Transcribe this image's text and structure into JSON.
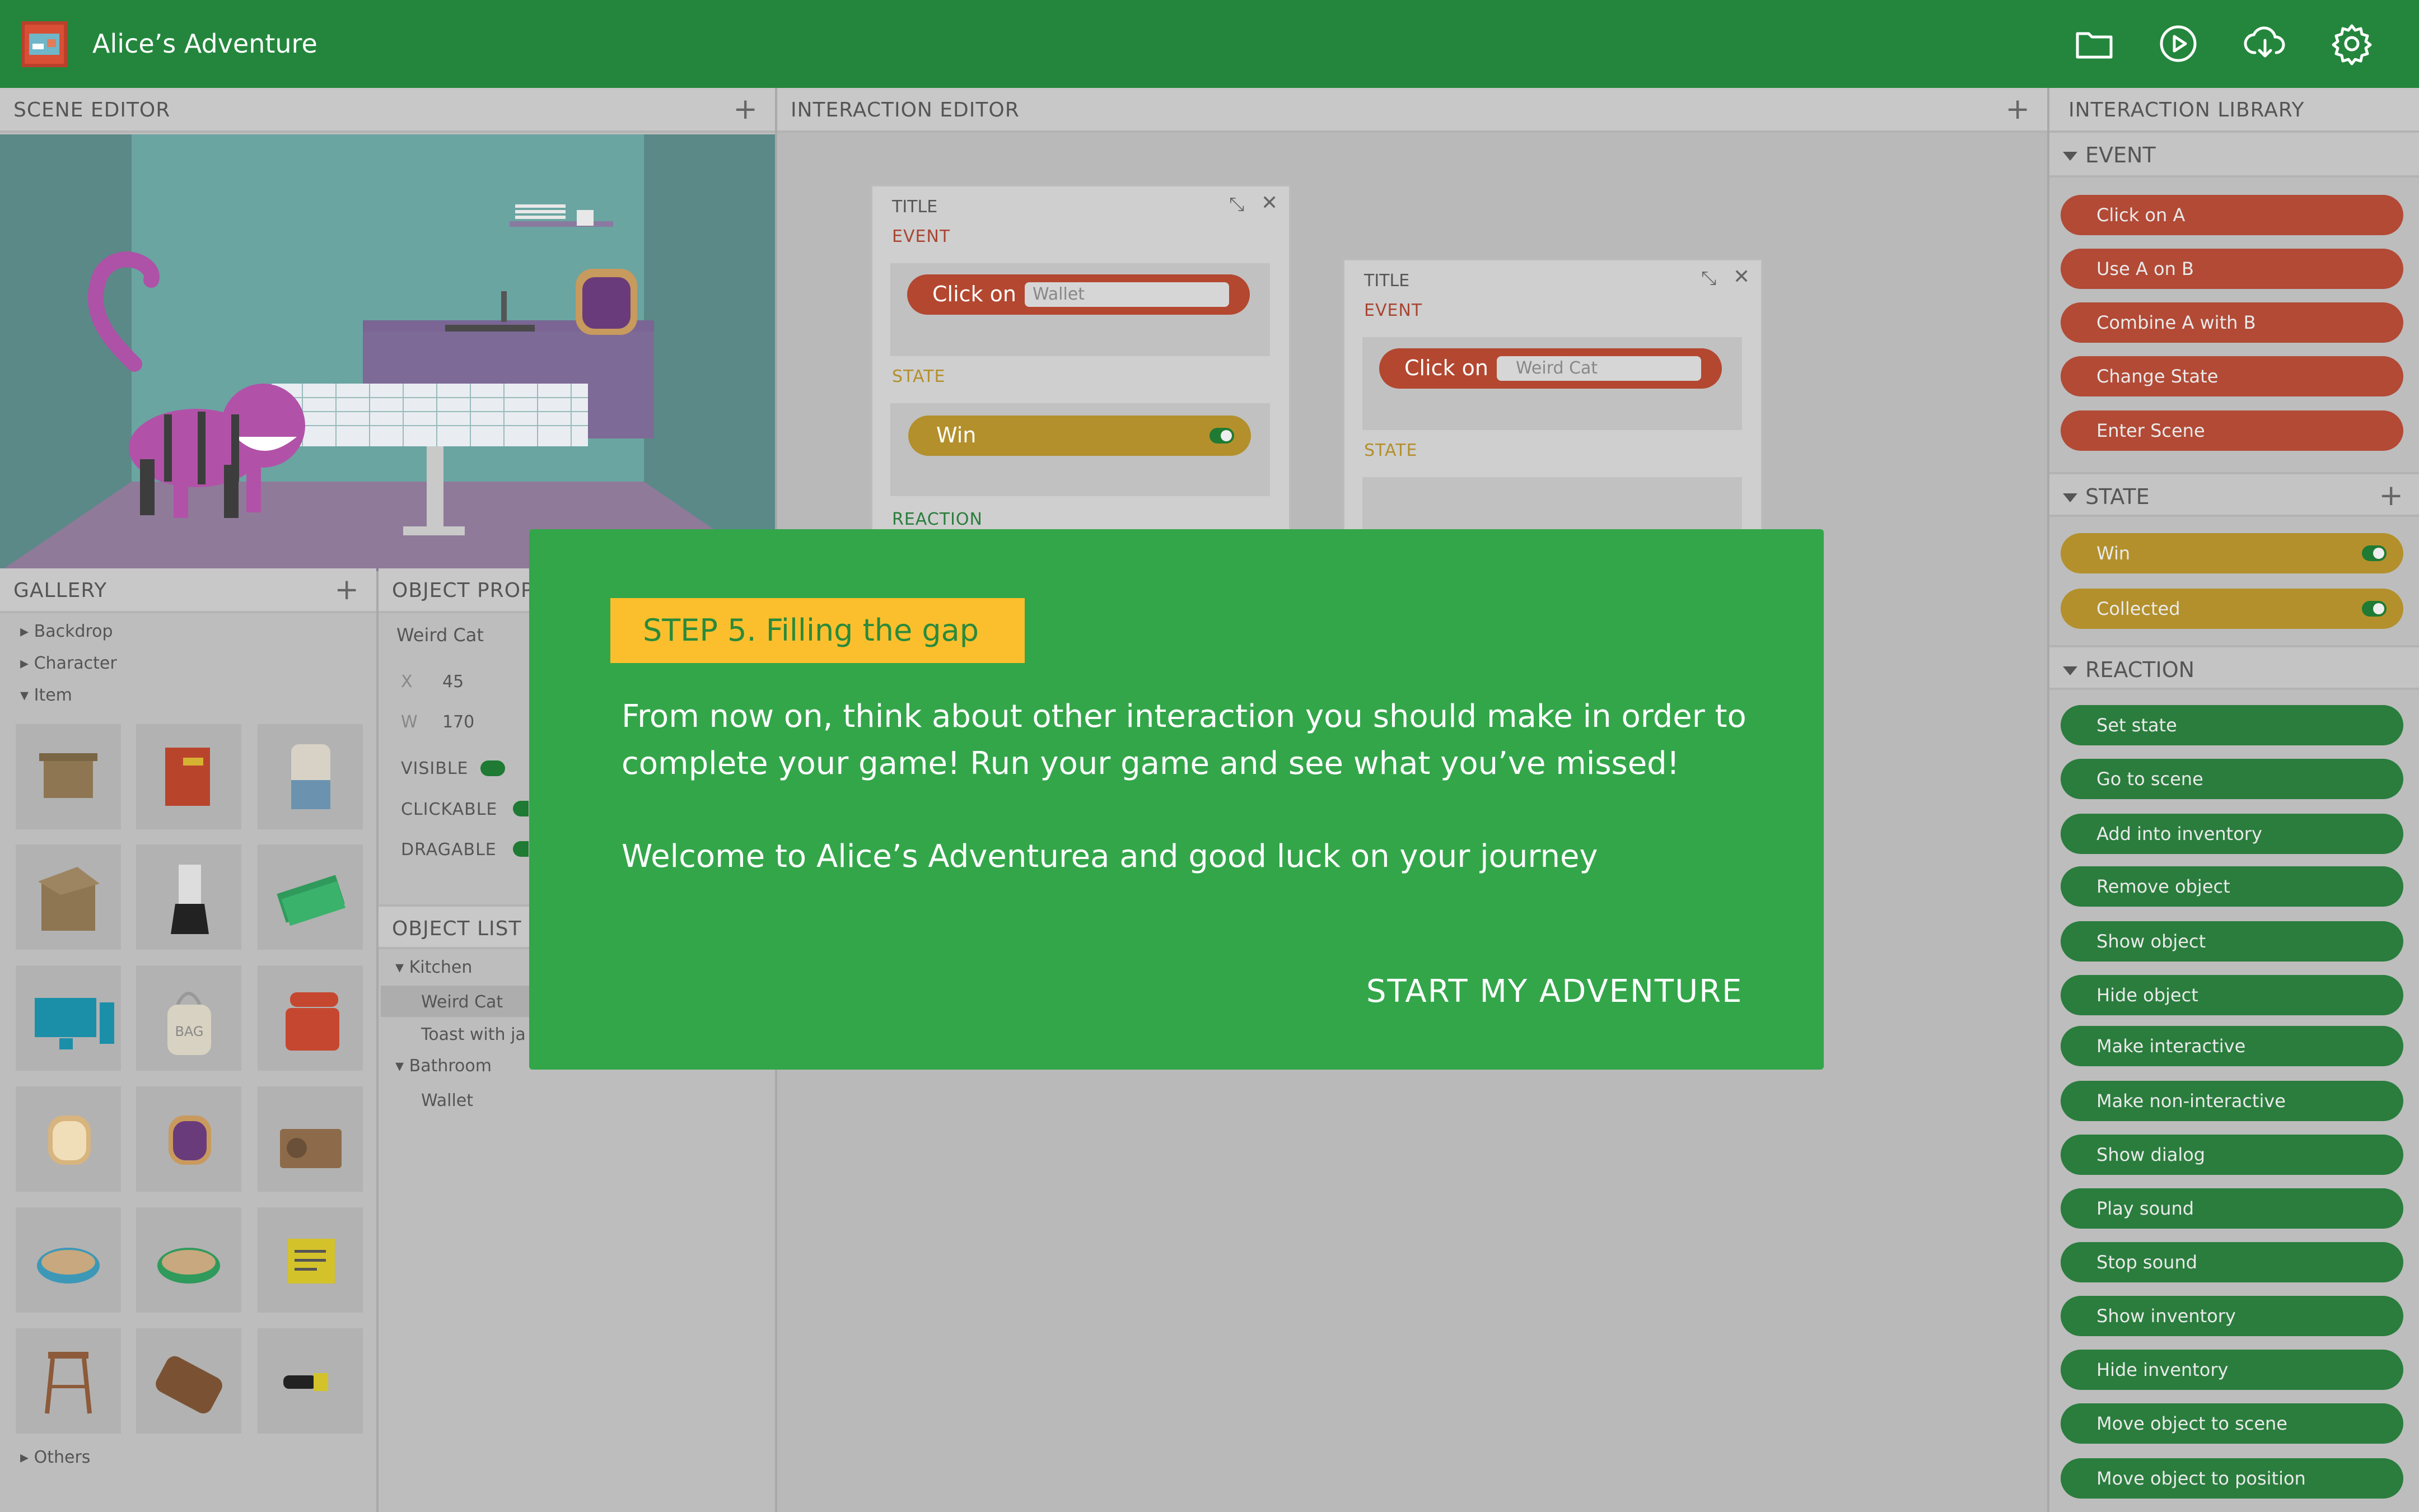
{
  "app": {
    "title": "Alice’s Adventure"
  },
  "toolbar": {
    "icons": [
      "folder-icon",
      "play-icon",
      "download-icon",
      "gear-icon"
    ]
  },
  "scene_editor": {
    "title": "SCENE EDITOR",
    "add": "+"
  },
  "interaction_editor": {
    "title": "INTERACTION EDITOR",
    "add": "+",
    "card1": {
      "title": "TITLE",
      "event": "EVENT",
      "event_action": "Click on",
      "event_target": "Wallet",
      "state": "STATE",
      "state_value": "Win",
      "reaction": "REACTION"
    },
    "card2": {
      "title": "TITLE",
      "event": "EVENT",
      "event_action": "Click on",
      "event_target": "Weird Cat",
      "state": "STATE"
    }
  },
  "gallery": {
    "title": "GALLERY",
    "add": "+",
    "items": [
      "Backdrop",
      "Character",
      "Item"
    ],
    "others": "Others",
    "bag_text": "BAG"
  },
  "object_properties": {
    "title": "OBJECT PROP",
    "name": "Weird Cat",
    "x_label": "X",
    "x_value": "45",
    "w_label": "W",
    "w_value": "170",
    "visible": "VISIBLE",
    "clickable": "CLICKABLE",
    "dragable": "DRAGABLE"
  },
  "object_list": {
    "title": "OBJECT LIST",
    "group1": "Kitchen",
    "g1_items": [
      "Weird Cat",
      "Toast with ja"
    ],
    "group2": "Bathroom",
    "g2_items": [
      "Wallet"
    ]
  },
  "library": {
    "title": "INTERACTION LIBRARY",
    "event_title": "EVENT",
    "events": [
      "Click on A",
      "Use A on B",
      "Combine A with B",
      "Change State",
      "Enter Scene"
    ],
    "state_title": "STATE",
    "state_add": "+",
    "states": [
      "Win",
      "Collected"
    ],
    "reaction_title": "REACTION",
    "reactions": [
      "Set state",
      "Go to scene",
      "Add into inventory",
      "Remove object",
      "Show object",
      "Hide object",
      "Make interactive",
      "Make non-interactive",
      "Show dialog",
      "Play sound",
      "Stop sound",
      "Show inventory",
      "Hide inventory",
      "Move object to scene",
      "Move object to position"
    ]
  },
  "modal": {
    "step": "STEP 5. Filling the gap",
    "text1": "From now on, think about other interaction you should make in order to complete your game! Run your game and see what you’ve missed!",
    "text2": "Welcome to Alice’s Adventurea and good luck on your journey",
    "cta": "START MY ADVENTURE"
  },
  "colors": {
    "topbar": "#23863c",
    "modal": "#33a64a",
    "step": "#fbbf2d",
    "event": "#b24a36",
    "state": "#b3902c",
    "reaction": "#2a7d3d"
  }
}
